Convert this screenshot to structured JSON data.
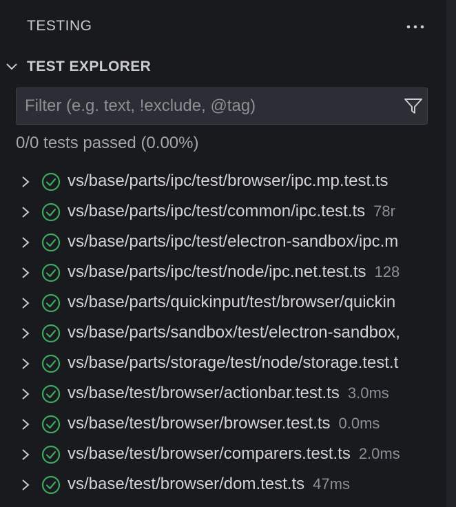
{
  "header": {
    "title": "TESTING",
    "more_actions_label": "···"
  },
  "section": {
    "title": "TEST EXPLORER",
    "expanded": true
  },
  "filter": {
    "placeholder": "Filter (e.g. text, !exclude, @tag)",
    "value": ""
  },
  "summary": "0/0 tests passed (0.00%)",
  "colors": {
    "pass": "#3fa860",
    "background": "#181a1e",
    "input_bg": "#2b2e34"
  },
  "tests": [
    {
      "label": "vs/base/parts/ipc/test/browser/ipc.mp.test.ts",
      "duration": ""
    },
    {
      "label": "vs/base/parts/ipc/test/common/ipc.test.ts",
      "duration": "78r"
    },
    {
      "label": "vs/base/parts/ipc/test/electron-sandbox/ipc.m",
      "duration": ""
    },
    {
      "label": "vs/base/parts/ipc/test/node/ipc.net.test.ts",
      "duration": "128"
    },
    {
      "label": "vs/base/parts/quickinput/test/browser/quickin",
      "duration": ""
    },
    {
      "label": "vs/base/parts/sandbox/test/electron-sandbox,",
      "duration": ""
    },
    {
      "label": "vs/base/parts/storage/test/node/storage.test.t",
      "duration": ""
    },
    {
      "label": "vs/base/test/browser/actionbar.test.ts",
      "duration": "3.0ms"
    },
    {
      "label": "vs/base/test/browser/browser.test.ts",
      "duration": "0.0ms"
    },
    {
      "label": "vs/base/test/browser/comparers.test.ts",
      "duration": "2.0ms"
    },
    {
      "label": "vs/base/test/browser/dom.test.ts",
      "duration": "47ms"
    }
  ]
}
